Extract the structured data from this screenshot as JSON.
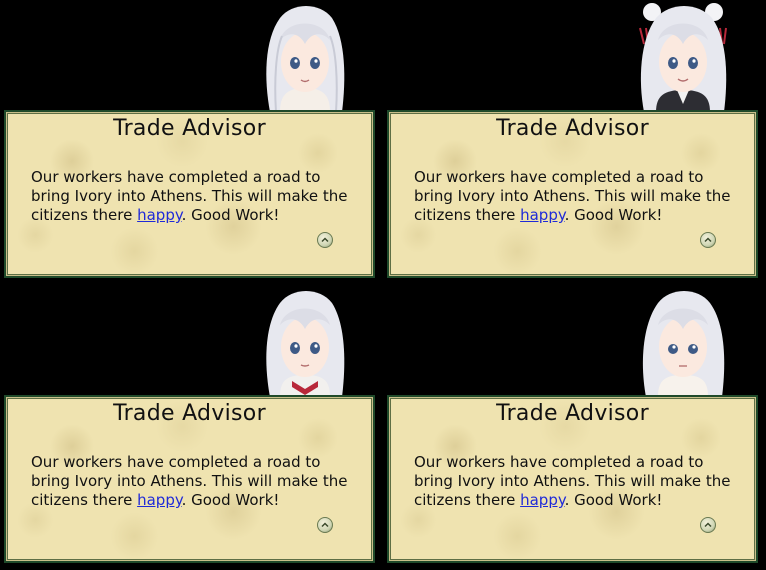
{
  "colors": {
    "background": "#000000",
    "panel": "#efe3b0",
    "panel_border": "#1f4a2a",
    "link": "#1f2ad8",
    "hair": "#e7e8ef",
    "eyes": "#3e5a86"
  },
  "popups": [
    {
      "title": "Trade Advisor",
      "message_before": "Our workers have completed a road to bring Ivory into Athens. This will make the citizens there ",
      "link_text": "happy",
      "message_after": ". Good Work!",
      "portrait_icon": "advisor-portrait",
      "button_icon": "chevron-up-icon"
    },
    {
      "title": "Trade Advisor",
      "message_before": "Our workers have completed a road to bring Ivory into Athens. This will make the citizens there ",
      "link_text": "happy",
      "message_after": ". Good Work!",
      "portrait_icon": "advisor-portrait",
      "button_icon": "chevron-up-icon"
    },
    {
      "title": "Trade Advisor",
      "message_before": "Our workers have completed a road to bring Ivory into Athens. This will make the citizens there ",
      "link_text": "happy",
      "message_after": ". Good Work!",
      "portrait_icon": "advisor-portrait",
      "button_icon": "chevron-up-icon"
    },
    {
      "title": "Trade Advisor",
      "message_before": "Our workers have completed a road to bring Ivory into Athens. This will make the citizens there ",
      "link_text": "happy",
      "message_after": ". Good Work!",
      "portrait_icon": "advisor-portrait",
      "button_icon": "chevron-up-icon"
    }
  ]
}
